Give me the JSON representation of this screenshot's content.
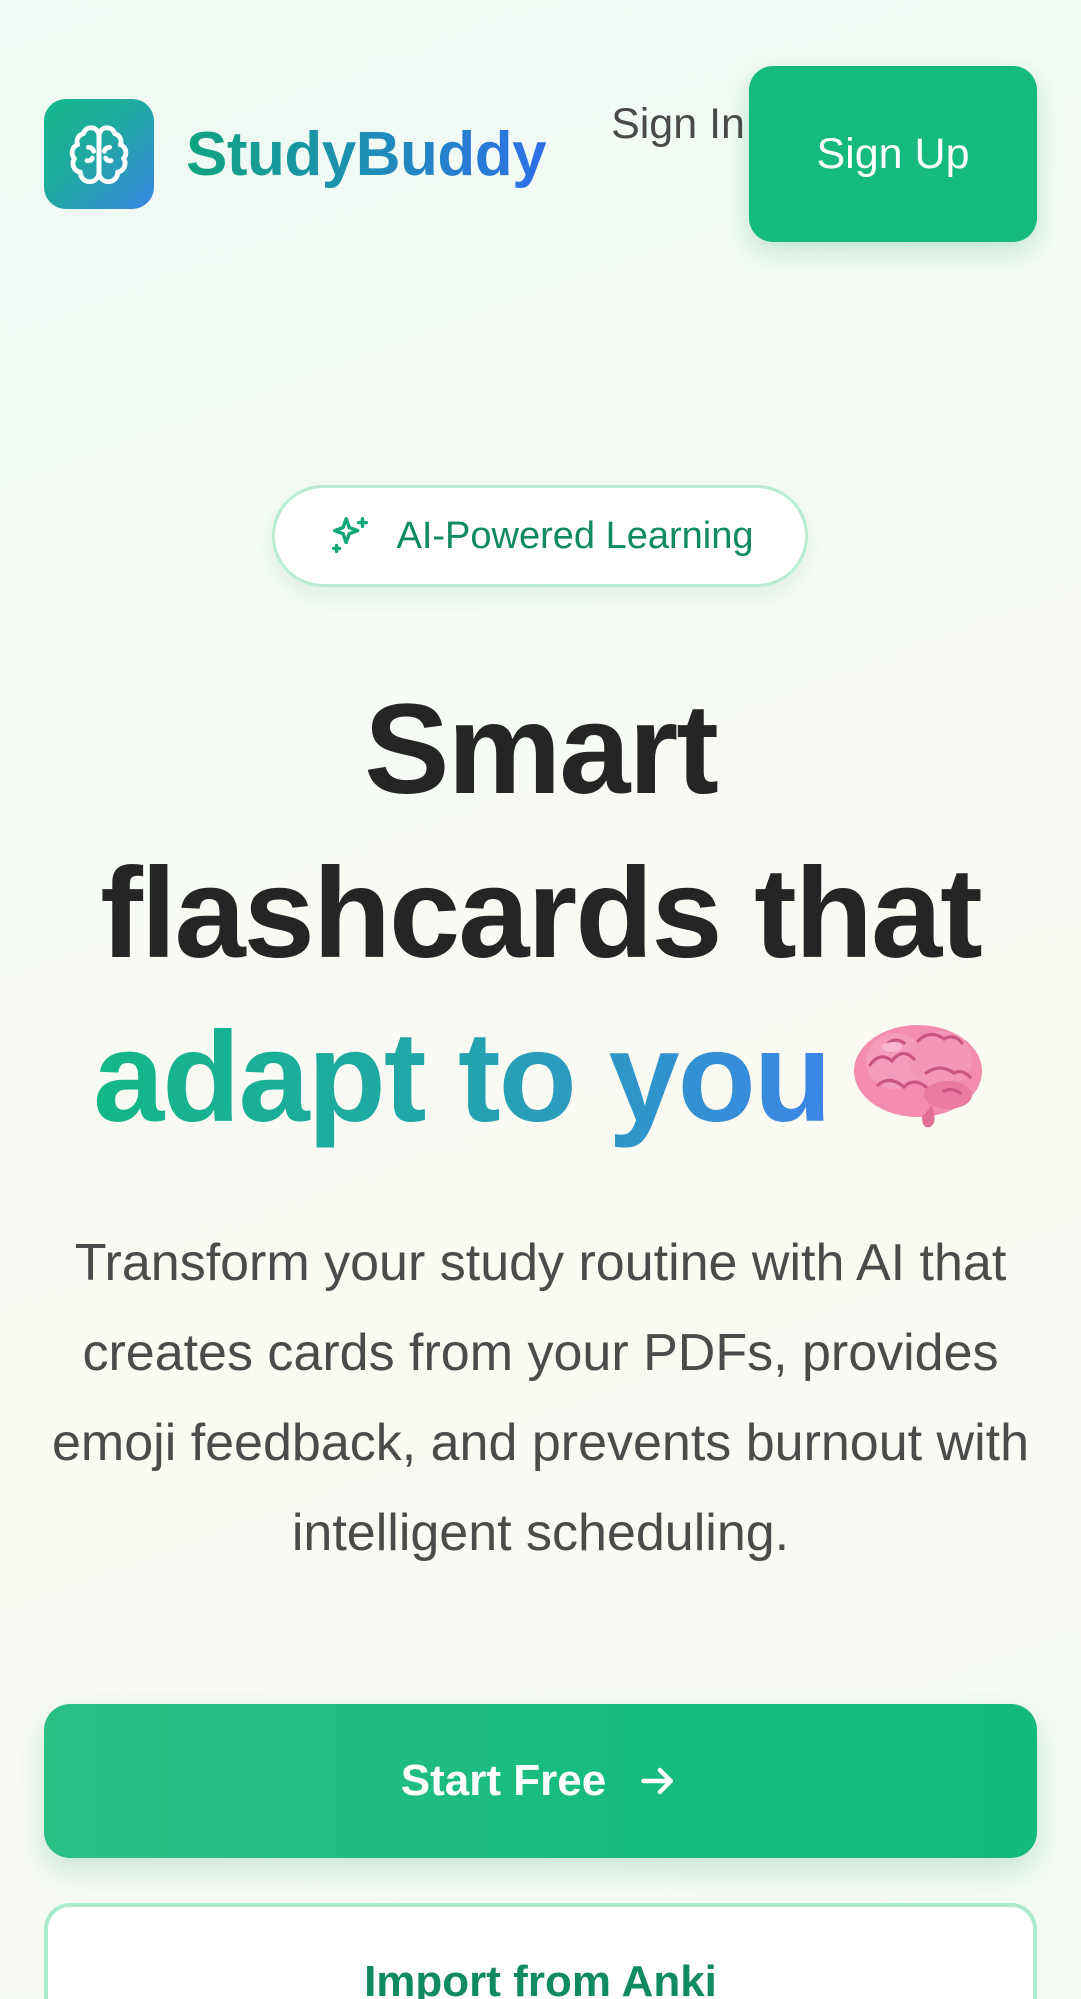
{
  "header": {
    "brand_name": "StudyBuddy",
    "logo_icon": "brain-icon",
    "sign_in_label": "Sign In",
    "sign_up_label": "Sign Up"
  },
  "hero": {
    "badge": {
      "icon": "sparkles-icon",
      "label": "AI-Powered Learning"
    },
    "headline_line1": "Smart",
    "headline_line2": "flashcards that",
    "headline_highlight": "adapt to you",
    "headline_emoji": "brain-emoji",
    "description": "Transform your study routine with AI that creates cards from your PDFs, provides emoji feedback, and prevents burnout with intelligent scheduling.",
    "primary_cta_label": "Start Free",
    "primary_cta_icon": "arrow-right-icon",
    "secondary_cta_label": "Import from Anki"
  },
  "colors": {
    "accent": "#15ba7f",
    "brand_gradient_start": "#14b88a",
    "brand_gradient_end": "#3a86e4",
    "text_dark": "#252525",
    "text_body": "#4b4b4b",
    "badge_text": "#0f8a62"
  }
}
